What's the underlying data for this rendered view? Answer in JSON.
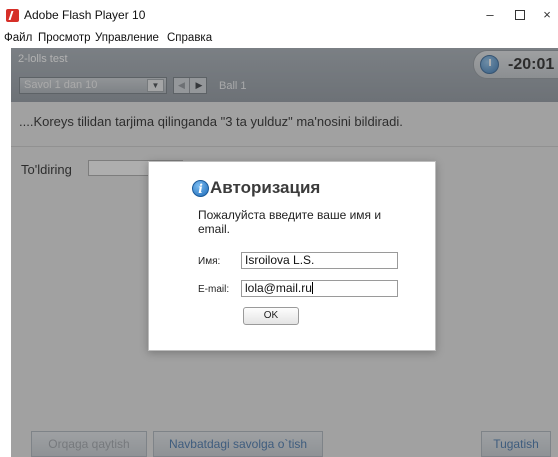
{
  "window": {
    "title": "Adobe Flash Player 10",
    "minimize": "–",
    "close": "×"
  },
  "menu": [
    "Файл",
    "Просмотр",
    "Управление",
    "Справка"
  ],
  "header": {
    "test_name": "2-lolls test",
    "question_select": "Savol  1 dan 10",
    "ball": "Ball 1",
    "timer": "-20:01"
  },
  "question": {
    "text": "....Koreys tilidan tarjima qilinganda \"3 ta yulduz\" ma'nosini bildiradi.",
    "fill_label": "To'ldiring",
    "fill_value": ""
  },
  "footer": {
    "back_label": "Orqaga qaytish",
    "next_label": "Navbatdagi savolga o`tish",
    "finish_label": "Tugatish"
  },
  "dialog": {
    "title": "Авторизация",
    "message": "Пожалуйста введите ваше имя и email.",
    "name_label": "Имя:",
    "name_value": "Isroilova L.S.",
    "email_label": "E-mail:",
    "email_value": "lola@mail.ru",
    "ok_label": "OK"
  },
  "icons": {
    "app": "flash-player-icon",
    "timer": "stopwatch-icon",
    "dialog": "info-icon"
  }
}
